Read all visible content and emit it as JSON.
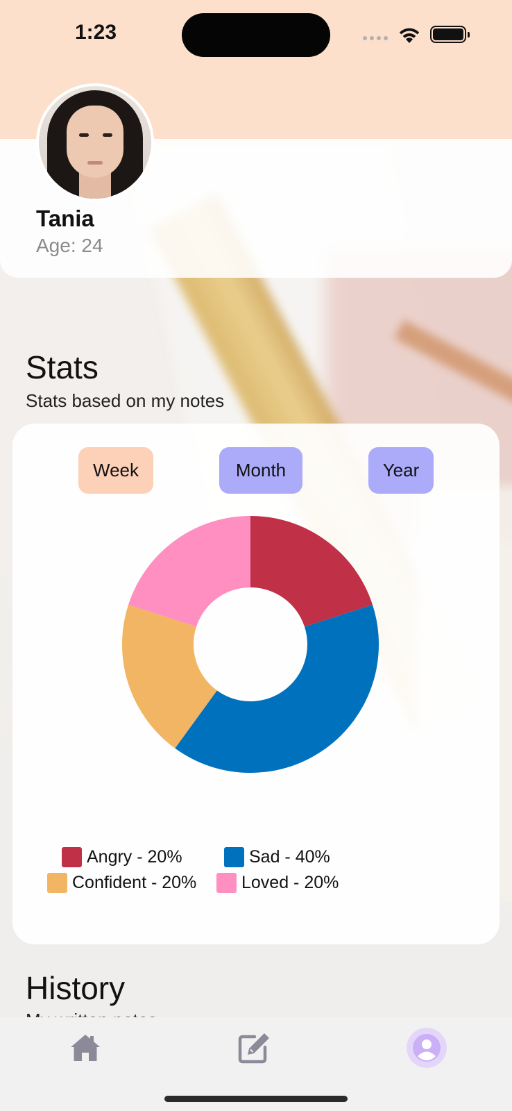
{
  "status_bar": {
    "time": "1:23"
  },
  "profile": {
    "name": "Tania",
    "age_label": "Age: 24"
  },
  "stats": {
    "title": "Stats",
    "subtitle": "Stats based on my notes",
    "range_buttons": [
      {
        "label": "Week",
        "color": "#fdd0b8"
      },
      {
        "label": "Month",
        "color": "#ababf9"
      },
      {
        "label": "Year",
        "color": "#ababf9"
      }
    ],
    "legend": [
      {
        "label": "Angry - 20%",
        "color": "#c03046"
      },
      {
        "label": "Sad - 40%",
        "color": "#0072bd"
      },
      {
        "label": "Confident - 20%",
        "color": "#f2b563"
      },
      {
        "label": "Loved - 20%",
        "color": "#fe8fc0"
      }
    ]
  },
  "chart_data": {
    "type": "pie",
    "style": "donut",
    "categories": [
      "Angry",
      "Sad",
      "Confident",
      "Loved"
    ],
    "values": [
      20,
      40,
      20,
      20
    ],
    "colors": [
      "#c03046",
      "#0072bd",
      "#f2b563",
      "#fe8fc0"
    ],
    "legend_position": "bottom-left"
  },
  "history": {
    "title": "History",
    "subtitle": "My written notes"
  },
  "tab_bar": {
    "items": [
      {
        "name": "home",
        "icon": "home-icon"
      },
      {
        "name": "notes",
        "icon": "edit-icon"
      },
      {
        "name": "profile",
        "icon": "person-icon",
        "active": true
      }
    ],
    "colors": {
      "inactive": "#8c8a98",
      "active": "#ffffff",
      "active_bg": "#e4d6fb"
    }
  }
}
